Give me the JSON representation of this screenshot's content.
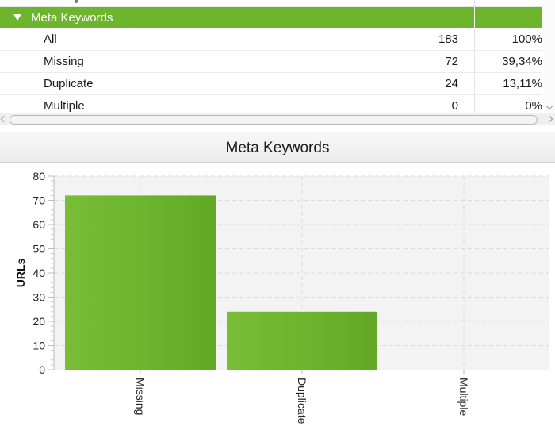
{
  "table": {
    "group_label": "Meta Keywords",
    "rows": [
      {
        "name": "All",
        "count": "183",
        "percent": "100%"
      },
      {
        "name": "Missing",
        "count": "72",
        "percent": "39,34%"
      },
      {
        "name": "Duplicate",
        "count": "24",
        "percent": "13,11%"
      },
      {
        "name": "Multiple",
        "count": "0",
        "percent": "0%"
      }
    ]
  },
  "chart_panel": {
    "title": "Meta Keywords"
  },
  "chart_data": {
    "type": "bar",
    "title": "Meta Keywords",
    "categories": [
      "Missing",
      "Duplicate",
      "Multiple"
    ],
    "values": [
      72,
      24,
      0
    ],
    "xlabel": "",
    "ylabel": "URLs",
    "ylim": [
      0,
      80
    ],
    "yticks": [
      0,
      10,
      20,
      30,
      40,
      50,
      60,
      70,
      80
    ],
    "grid": true,
    "bar_color": "#6cb52d"
  },
  "colors": {
    "accent": "#6cb52d",
    "plot_background": "#f3f3f3"
  }
}
